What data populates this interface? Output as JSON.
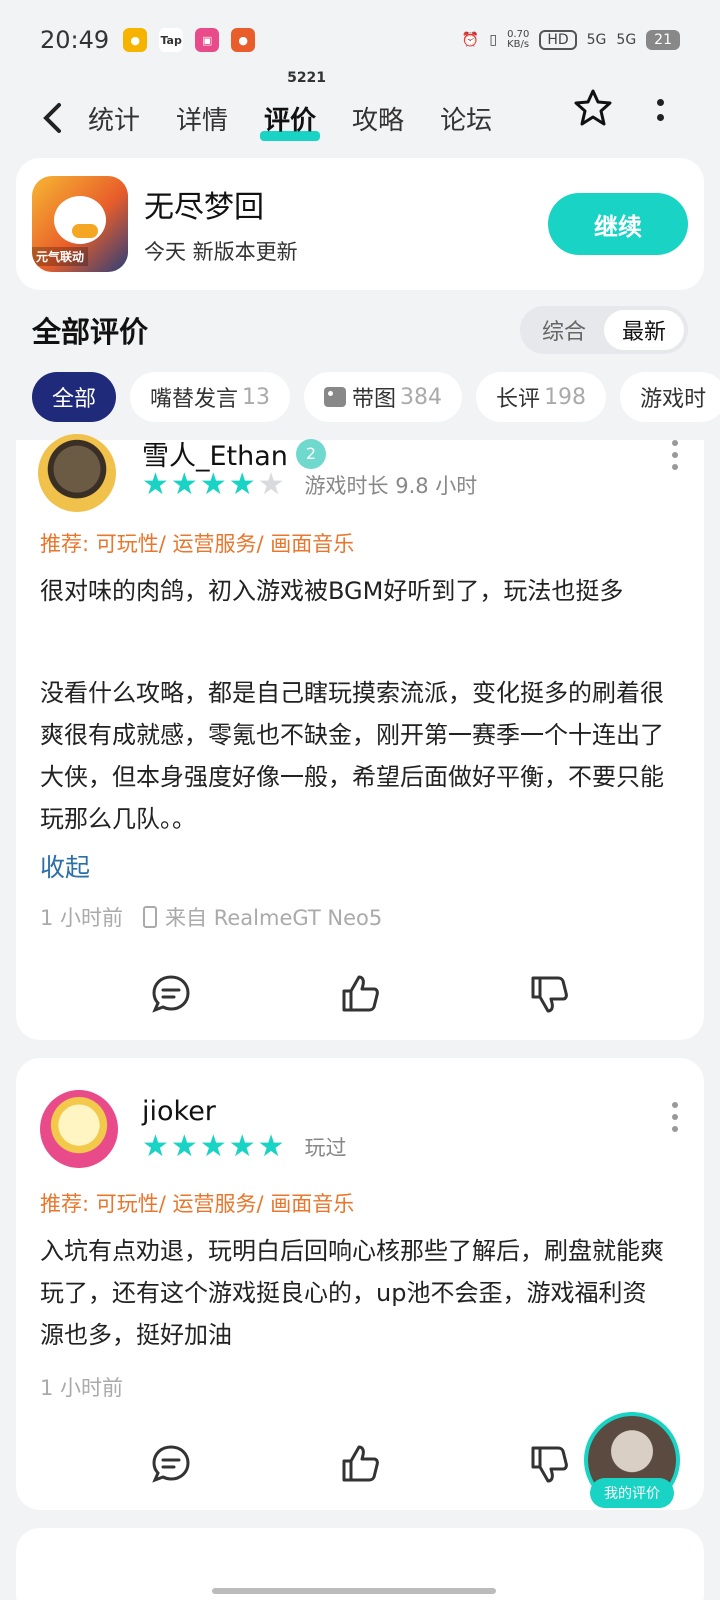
{
  "status_bar": {
    "time": "20:49",
    "speed": "0.70\nKB/s",
    "net1": "5G",
    "net2": "5G",
    "battery": "21",
    "hd": "HD"
  },
  "nav": {
    "tabs": [
      {
        "label": "统计"
      },
      {
        "label": "详情"
      },
      {
        "label": "评价",
        "count": "5221"
      },
      {
        "label": "攻略"
      },
      {
        "label": "论坛"
      }
    ]
  },
  "game": {
    "name": "无尽梦回",
    "subtitle": "今天 新版本更新",
    "button": "继续",
    "icon_badge": "元气联动"
  },
  "reviews_section": {
    "title": "全部评价",
    "sort_options": [
      "综合",
      "最新"
    ],
    "sort_selected": "最新"
  },
  "chips": [
    {
      "label": "全部",
      "count": ""
    },
    {
      "label": "嘴替发言",
      "count": "13"
    },
    {
      "label": "带图",
      "count": "384"
    },
    {
      "label": "长评",
      "count": "198"
    },
    {
      "label": "游戏时",
      "count": ""
    }
  ],
  "reviews": [
    {
      "user": "雪人_Ethan",
      "level": "2",
      "stars": 4,
      "play_info": "游戏时长 9.8 小时",
      "tags": "推荐: 可玩性/ 运营服务/ 画面音乐",
      "text1": "很对味的肉鸽，初入游戏被BGM好听到了，玩法也挺多",
      "text2": "没看什么攻略，都是自己瞎玩摸索流派，变化挺多的刷着很爽很有成就感，零氪也不缺金，刚开第一赛季一个十连出了大侠，但本身强度好像一般，希望后面做好平衡，不要只能玩那么几队。。",
      "collapse": "收起",
      "time": "1 小时前",
      "device": "来自 RealmeGT Neo5"
    },
    {
      "user": "jioker",
      "stars": 5,
      "play_info": "玩过",
      "tags": "推荐: 可玩性/ 运营服务/ 画面音乐",
      "text": "入坑有点劝退，玩明白后回响心核那些了解后，刷盘就能爽玩了，还有这个游戏挺良心的，up池不会歪，游戏福利资源也多，挺好加油",
      "time": "1 小时前"
    }
  ],
  "floating": {
    "label": "我的评价"
  },
  "colors": {
    "accent": "#19d3c5",
    "chip_active": "#1f2a7a",
    "tag": "#e8762d",
    "link": "#2a6fa8"
  },
  "icons": [
    "back-icon",
    "star-outline-icon",
    "more-vertical-icon",
    "comment-icon",
    "thumbs-up-icon",
    "thumbs-down-icon",
    "phone-icon",
    "image-icon"
  ]
}
